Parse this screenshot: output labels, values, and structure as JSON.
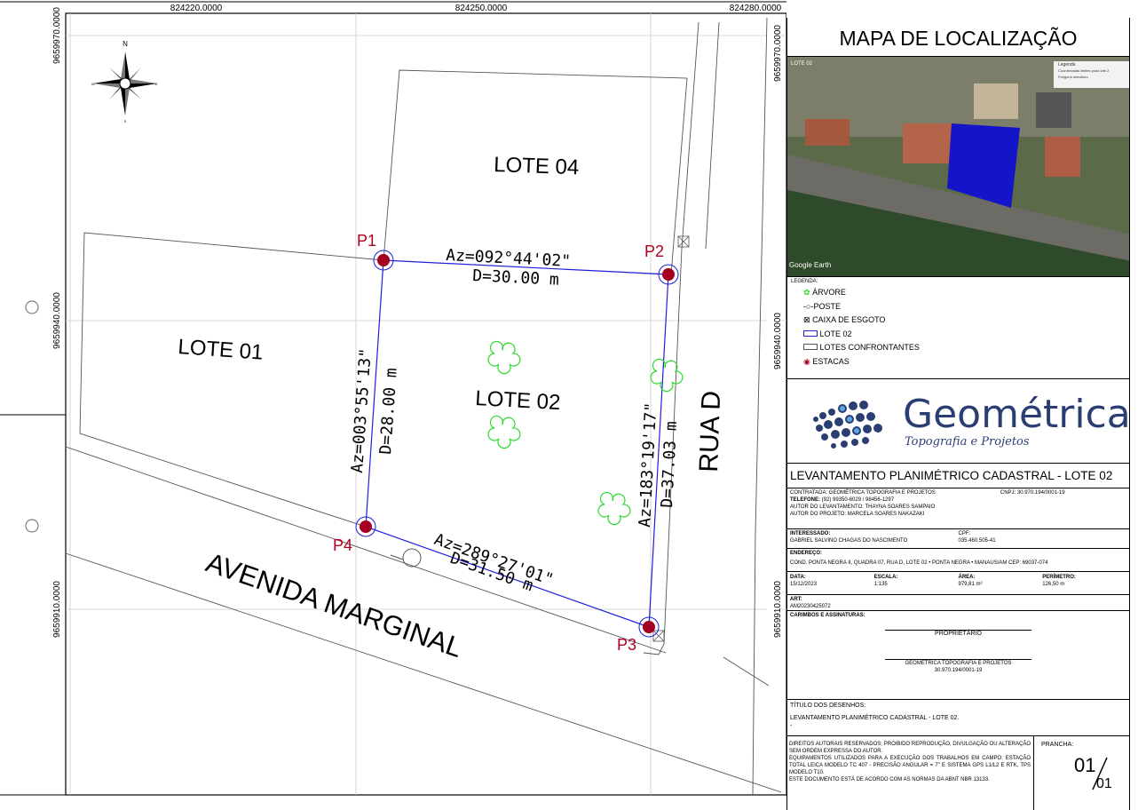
{
  "grid": {
    "x_labels": [
      "824220.0000",
      "824250.0000",
      "824280.0000"
    ],
    "y_labels": [
      "9659970.0000",
      "9659940.0000",
      "9659910.0000"
    ],
    "y_labels_right": [
      "9659970.0000",
      "9659940.0000",
      "9659910.0000"
    ]
  },
  "compass": {
    "n": "N",
    "s": "S",
    "e": "E",
    "w": "W"
  },
  "map": {
    "lote04": "LOTE 04",
    "lote01": "LOTE 01",
    "lote02": "LOTE 02",
    "rua_d": "RUA D",
    "avenida": "AVENIDA MARGINAL",
    "stakes": [
      {
        "name": "P1"
      },
      {
        "name": "P2"
      },
      {
        "name": "P3"
      },
      {
        "name": "P4"
      }
    ],
    "segments": {
      "p1p2": {
        "az": "Az=092°44'02\"",
        "d": "D=30.00  m"
      },
      "p2p3": {
        "az": "Az=183°19'17\"",
        "d": "D=37.03  m"
      },
      "p3p4": {
        "az": "Az=289°27'01\"",
        "d": "D=31.50  m"
      },
      "p4p1": {
        "az": "Az=003°55'13\"",
        "d": "D=28.00  m"
      }
    }
  },
  "panel": {
    "title": "MAPA DE LOCALIZAÇÃO",
    "inset_label": "LOTE 02",
    "inset_legend_title": "Legenda",
    "inset_legend_1": "Coordenadas limites poda lote 2",
    "inset_legend_2": "Polígono semáforo",
    "google": "Google Earth",
    "legend_title": "LEGENDA:",
    "legend": {
      "arvore": "ÁRVORE",
      "poste": "POSTE",
      "caixa": "CAIXA DE ESGOTO",
      "lote": "LOTE 02",
      "confrontantes": "LOTES CONFRONTANTES",
      "estacas": "ESTACAS"
    },
    "logo_name": "Geométrica",
    "logo_sub": "Topografia e Projetos",
    "survey_title": "LEVANTAMENTO PLANIMÉTRICO CADASTRAL - LOTE 02",
    "contratada": "CONTRATADA: GEOMÉTRICA TOPOGRAFIA E PROJETOS",
    "cnpj": "CNPJ: 30.970.194/0001-19",
    "telefone_label": "TELEFONE:",
    "telefone": "(92) 99350-6029 / 98456-1297",
    "autor_lev": "AUTOR  DO  LEVANTAMENTO: THAYNA SOARES SAMPAIO",
    "autor_proj": "AUTOR  DO  PROJETO: MARCELA SOARES NAKAZAKI",
    "interessado_label": "INTERESSADO:",
    "interessado": "GABRIEL SALVINO CHAGAS DO NASCIMENTO",
    "cpf_label": "CPF:",
    "cpf": "035.460.505-41",
    "endereco_label": "ENDEREÇO:",
    "endereco": "COND. PONTA NEGRA II, QUADRA 07, RUA D, LOTE 02  •  PONTA NEGRA • MANAUS/AM  CEP: 69037-074",
    "data_label": "DATA:",
    "data": "15/12/2023",
    "escala_label": "ESCALA:",
    "escala": "1:135",
    "area_label": "ÁREA:",
    "area": "979,81 m²",
    "perimetro_label": "PERÍMETRO:",
    "perimetro": "126,50 m",
    "art_label": "ART:",
    "art": "AM20230425072",
    "carimbos": "CARIMBOS  E  ASSINATURAS:",
    "proprietario": "PROPRIETÁRIO",
    "geo_sign": "GEOMÉTRICA TOPOGRAFIA E PROJETOS",
    "geo_cnpj": "30.970.194/0001-19",
    "titulo_label": "TÍTULO  DOS  DESENHOS:",
    "titulo": "LEVANTAMENTO PLANIMÉTRICO CADASTRAL - LOTE 02.",
    "dash": "-",
    "direitos": "DIREITOS AUTORAIS RESERVADOS; PROIBIDO REPRODUÇÃO, DIVULGAÇÃO OU ALTERAÇÃO SEM ORDEM EXPRESSA DO AUTOR.",
    "equip": "EQUIPAMENTOS UTILIZADOS PARA A EXECUÇÃO DOS TRABALHOS EM CAMPO: ESTAÇÃO TOTAL LEICA MODELO TC 407 - PRECISÃO ANGULAR = 7\" E SISTEMA GPS L1/L2 E RTK, TPS MODELO T10.",
    "normas": "ESTE DOCUMENTO ESTÁ DE ACORDO COM AS NORMAS DA ABNT NBR 13133.",
    "prancha_label": "PRANCHA:",
    "prancha_num": "01",
    "prancha_den": "01"
  },
  "colors": {
    "stake": "#a50021",
    "lot": "#1f1fdc",
    "tree": "#2fd82f",
    "label_red": "#b00020"
  }
}
